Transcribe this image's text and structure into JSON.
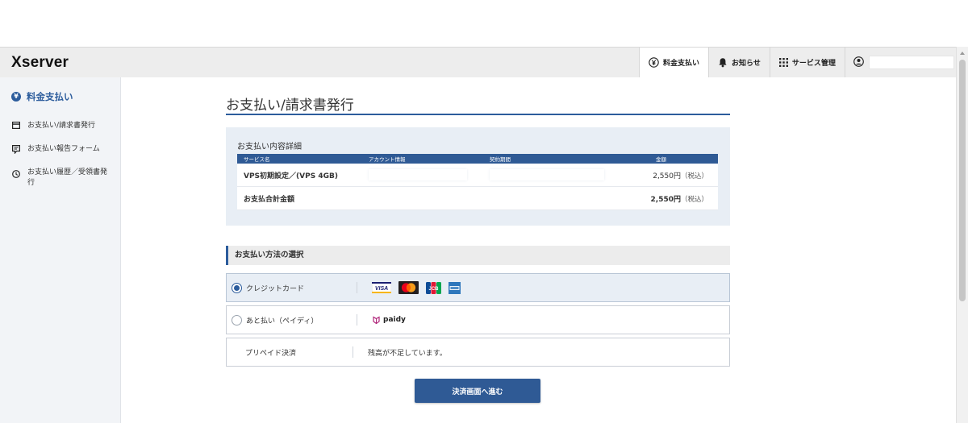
{
  "header": {
    "logo": "Xserver",
    "nav": [
      {
        "label": "料金支払い",
        "icon": "yen-circle-icon",
        "active": true
      },
      {
        "label": "お知らせ",
        "icon": "bell-icon",
        "active": false
      },
      {
        "label": "サービス管理",
        "icon": "grid-icon",
        "active": false
      }
    ],
    "account_icon": "user-circle-icon",
    "account_name": ""
  },
  "sidebar": {
    "title": "料金支払い",
    "items": [
      {
        "label": "お支払い/請求書発行",
        "icon": "card-icon"
      },
      {
        "label": "お支払い報告フォーム",
        "icon": "report-form-icon"
      },
      {
        "label": "お支払い履歴／受領書発行",
        "icon": "clock-icon"
      }
    ]
  },
  "main": {
    "title": "お支払い/請求書発行",
    "detail": {
      "heading": "お支払い内容詳細",
      "columns": [
        "サービス名",
        "アカウント情報",
        "契約期間",
        "金額"
      ],
      "rows": [
        {
          "service": "VPS初期設定／(VPS 4GB)",
          "account": "",
          "period": "",
          "amount": "2,550円",
          "tax": "（税込）"
        }
      ],
      "total": {
        "label": "お支払合計金額",
        "amount": "2,550円",
        "tax": "（税込）"
      }
    },
    "method": {
      "heading": "お支払い方法の選択",
      "options": [
        {
          "label": "クレジットカード",
          "selected": true,
          "logos": [
            "visa-logo",
            "mastercard-logo",
            "jcb-logo",
            "amex-logo"
          ]
        },
        {
          "label": "あと払い（ペイディ）",
          "selected": false,
          "brand": "paidy"
        },
        {
          "label": "プリペイド決済",
          "selected": false,
          "note": "残高が不足しています。"
        }
      ]
    },
    "submit": "決済画面へ進む"
  },
  "colors": {
    "accent": "#2c5c9c",
    "table_header": "#2f5a95",
    "panel": "#e8eef5"
  }
}
